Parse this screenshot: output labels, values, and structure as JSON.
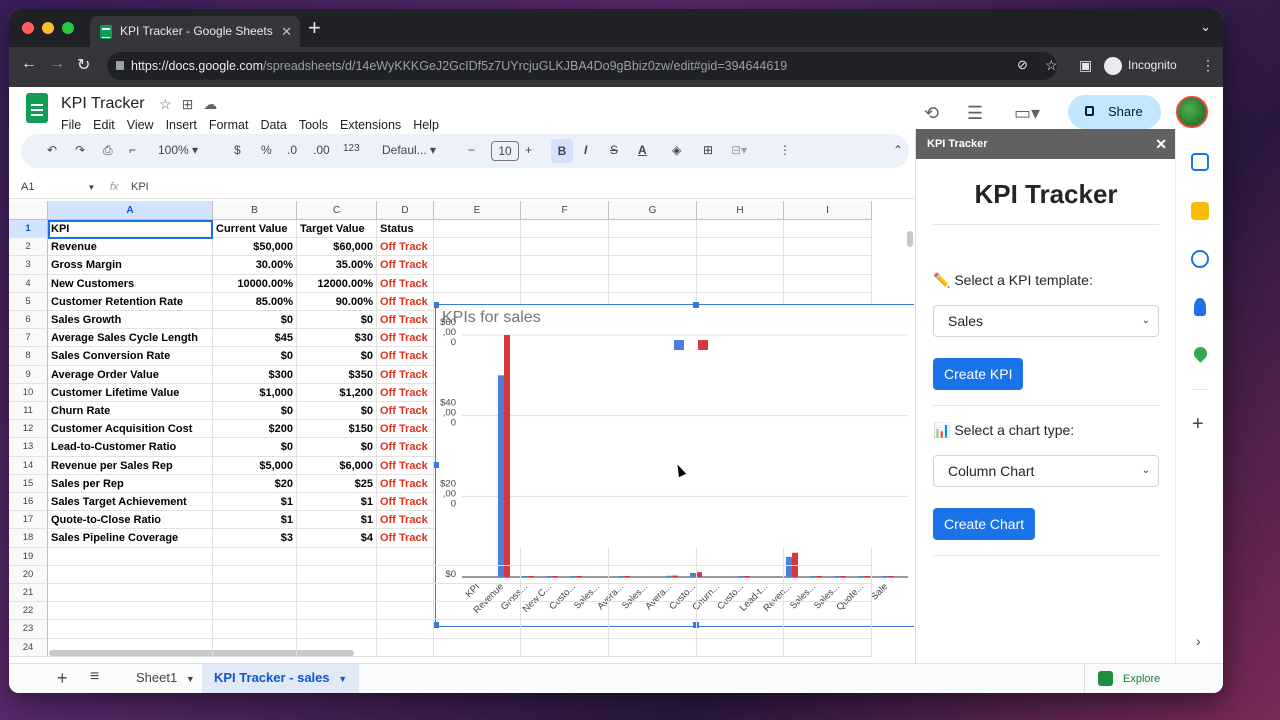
{
  "browser": {
    "tab_title": "KPI Tracker - Google Sheets",
    "url_host": "https://docs.google.com",
    "url_path": "/spreadsheets/d/14eWyKKKGeJ2GcIDf5z7UYrcjuGLKJBA4Do9gBbiz0zw/edit#gid=394644619",
    "profile_label": "Incognito"
  },
  "doc": {
    "title": "KPI Tracker",
    "menus": [
      "File",
      "Edit",
      "View",
      "Insert",
      "Format",
      "Data",
      "Tools",
      "Extensions",
      "Help"
    ],
    "share_label": "Share"
  },
  "toolbar": {
    "zoom": "100%",
    "currency": "$",
    "percent": "%",
    "dec_decrease": ".0",
    "dec_increase": ".00",
    "number_format": "123",
    "font": "Defaul...",
    "font_size": "10",
    "bold": "B",
    "italic": "I",
    "strikethrough": "S",
    "text_color": "A"
  },
  "formula_bar": {
    "cell_ref": "A1",
    "fx": "fx",
    "content": "KPI"
  },
  "grid": {
    "columns": [
      "A",
      "B",
      "C",
      "D",
      "E",
      "F",
      "G",
      "H",
      "I"
    ],
    "row_numbers": [
      "1",
      "2",
      "3",
      "4",
      "5",
      "6",
      "7",
      "8",
      "9",
      "10",
      "11",
      "12",
      "13",
      "14",
      "15",
      "16",
      "17",
      "18",
      "19",
      "20",
      "21",
      "22",
      "23",
      "24"
    ],
    "rows": [
      [
        "KPI",
        "Current Value",
        "Target Value",
        "Status"
      ],
      [
        "Revenue",
        "$50,000",
        "$60,000",
        "Off Track"
      ],
      [
        "Gross Margin",
        "30.00%",
        "35.00%",
        "Off Track"
      ],
      [
        "New Customers",
        "10000.00%",
        "12000.00%",
        "Off Track"
      ],
      [
        "Customer Retention Rate",
        "85.00%",
        "90.00%",
        "Off Track"
      ],
      [
        "Sales Growth",
        "$0",
        "$0",
        "Off Track"
      ],
      [
        "Average Sales Cycle Length",
        "$45",
        "$30",
        "Off Track"
      ],
      [
        "Sales Conversion Rate",
        "$0",
        "$0",
        "Off Track"
      ],
      [
        "Average Order Value",
        "$300",
        "$350",
        "Off Track"
      ],
      [
        "Customer Lifetime Value",
        "$1,000",
        "$1,200",
        "Off Track"
      ],
      [
        "Churn Rate",
        "$0",
        "$0",
        "Off Track"
      ],
      [
        "Customer Acquisition Cost",
        "$200",
        "$150",
        "Off Track"
      ],
      [
        "Lead-to-Customer Ratio",
        "$0",
        "$0",
        "Off Track"
      ],
      [
        "Revenue per Sales Rep",
        "$5,000",
        "$6,000",
        "Off Track"
      ],
      [
        "Sales per Rep",
        "$20",
        "$25",
        "Off Track"
      ],
      [
        "Sales Target Achievement",
        "$1",
        "$1",
        "Off Track"
      ],
      [
        "Quote-to-Close Ratio",
        "$1",
        "$1",
        "Off Track"
      ],
      [
        "Sales Pipeline Coverage",
        "$3",
        "$4",
        "Off Track"
      ]
    ]
  },
  "chart_data": {
    "type": "bar",
    "title": "KPIs for sales",
    "xlabel": "",
    "ylabel": "",
    "ylim": [
      0,
      60000
    ],
    "y_tick_labels": [
      "$60\n,00\n0",
      "$40\n,00\n0",
      "$20\n,00\n0",
      "$0"
    ],
    "categories": [
      "KPI",
      "Revenue",
      "Gross...",
      "New C...",
      "Custo...",
      "Sales...",
      "Avera...",
      "Sales...",
      "Avera...",
      "Custo...",
      "Churn...",
      "Custo...",
      "Lead-t...",
      "Reven...",
      "Sales...",
      "Sales...",
      "Quote...",
      "Sale"
    ],
    "series": [
      {
        "color": "#4a7fdc",
        "values": [
          0,
          50000,
          0.3,
          100,
          0.85,
          0,
          45,
          0,
          300,
          1000,
          0,
          200,
          0,
          5000,
          20,
          1,
          1,
          3
        ]
      },
      {
        "color": "#d8373b",
        "values": [
          0,
          60000,
          0.35,
          120,
          0.9,
          0,
          30,
          0,
          350,
          1200,
          0,
          150,
          0,
          6000,
          25,
          1,
          1,
          4
        ]
      }
    ],
    "legend": "top-right"
  },
  "sheets": {
    "tabs": [
      "Sheet1",
      "KPI Tracker - sales"
    ],
    "active": "KPI Tracker - sales",
    "explore_label": "Explore"
  },
  "sidebar": {
    "header": "KPI Tracker",
    "heading": "KPI Tracker",
    "template_label": "✏️ Select a KPI template:",
    "template_value": "Sales",
    "create_kpi": "Create KPI",
    "chart_label": "📊 Select a chart type:",
    "chart_value": "Column Chart",
    "create_chart": "Create Chart"
  },
  "colors": {
    "accent": "#1a73e8",
    "off_track": "#e0311c",
    "sheets_green": "#0f9d58"
  }
}
